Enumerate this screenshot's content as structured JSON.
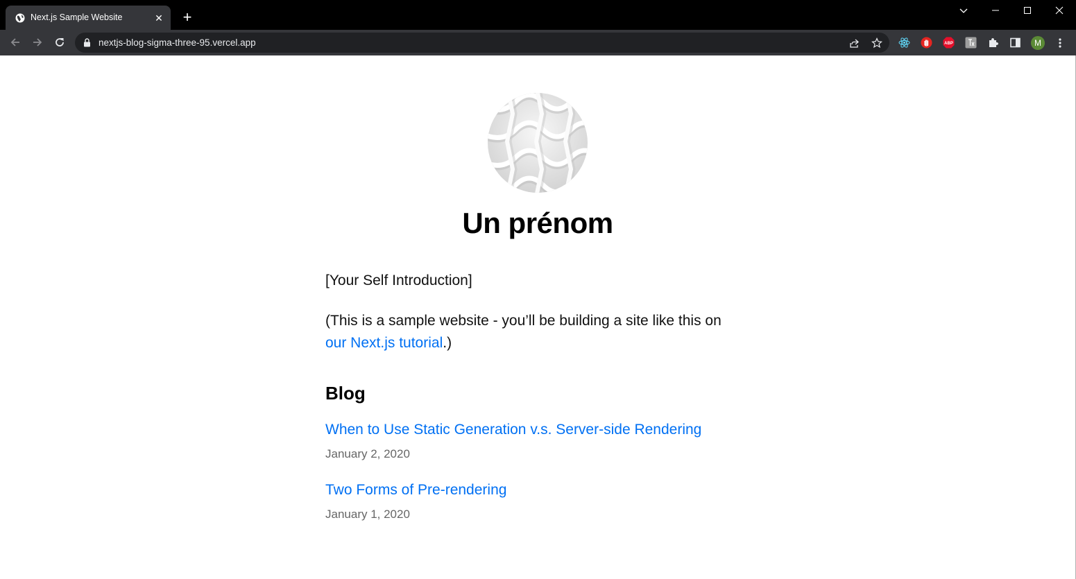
{
  "browser": {
    "tab_title": "Next.js Sample Website",
    "tab_close": "✕",
    "new_tab": "+",
    "url": "nextjs-blog-sigma-three-95.vercel.app",
    "profile_initial": "M",
    "icons": {
      "back": "back-arrow-icon",
      "forward": "forward-arrow-icon",
      "reload": "reload-icon",
      "lock": "lock-icon",
      "share": "share-icon",
      "bookmark": "star-icon",
      "extensions": [
        "react-devtools-icon",
        "block-hand-icon",
        "adblock-plus-icon",
        "translate-icon",
        "puzzle-icon",
        "side-panel-icon"
      ],
      "menu": "kebab-menu-icon"
    },
    "colors": {
      "titlebar": "#000000",
      "toolbar": "#35363a",
      "omnibox": "#202124"
    }
  },
  "page": {
    "title": "Un prénom",
    "intro": "[Your Self Introduction]",
    "sample_text_before": "(This is a sample website - you’ll be building a site like this on ",
    "sample_link_text": "our Next.js tutorial",
    "sample_text_after": ".)",
    "blog_heading": "Blog",
    "posts": [
      {
        "title": "When to Use Static Generation v.s. Server-side Rendering",
        "date": "January 2, 2020"
      },
      {
        "title": "Two Forms of Pre-rendering",
        "date": "January 1, 2020"
      }
    ],
    "colors": {
      "link": "#0070f3",
      "date": "#666666"
    }
  }
}
